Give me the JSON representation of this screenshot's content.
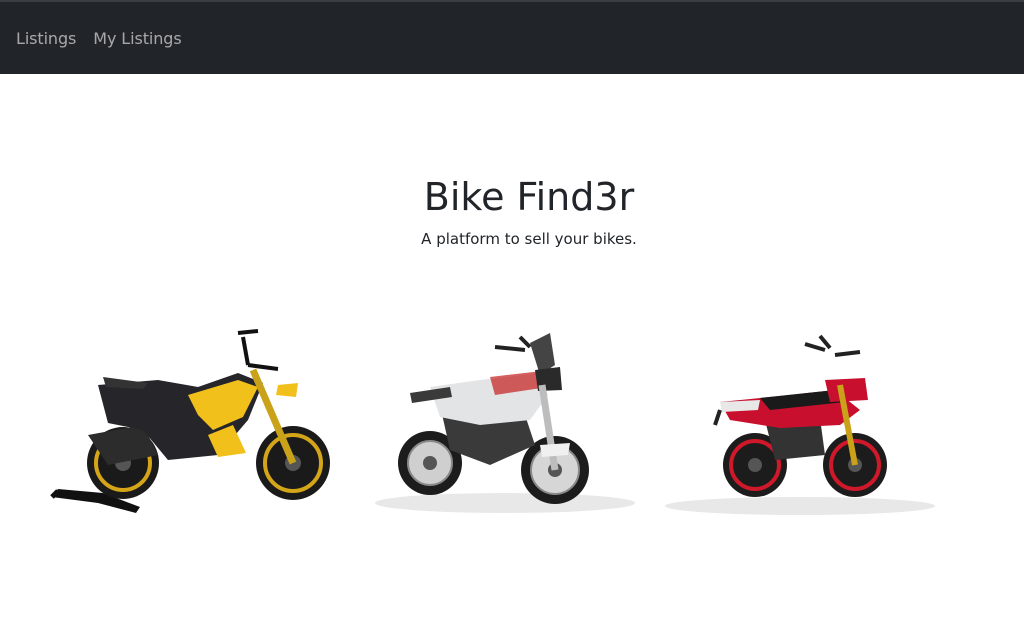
{
  "navbar": {
    "links": [
      {
        "label": "Listings"
      },
      {
        "label": "My Listings"
      }
    ],
    "background": "#212529"
  },
  "hero": {
    "title": "Bike Find3r",
    "subtitle": "A platform to sell your bikes."
  },
  "bikes": [
    {
      "image": "naked-streetfighter-yellow-black-on-paddock-stand",
      "accent": "#f2c01a"
    },
    {
      "image": "adventure-bike-white-grey",
      "accent": "#d9dadb"
    },
    {
      "image": "supermoto-red-black",
      "accent": "#c8102e"
    }
  ]
}
